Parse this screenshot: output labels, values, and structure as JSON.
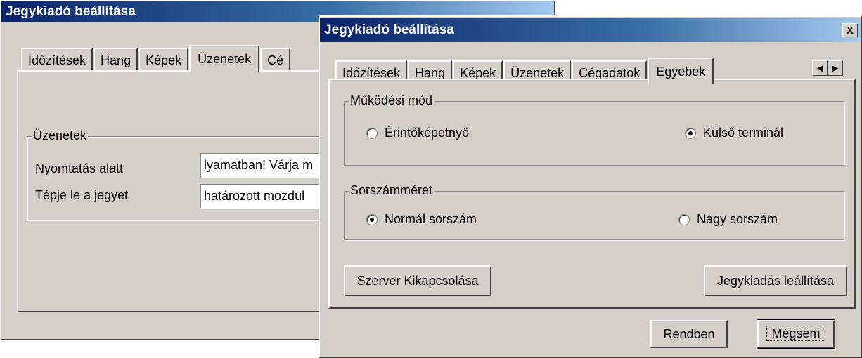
{
  "back_window": {
    "title": "Jegykiadó beállítása",
    "tabs": [
      "Időzítések",
      "Hang",
      "Képek",
      "Üzenetek",
      "Cé"
    ],
    "group_label": "Üzenetek",
    "rows": [
      {
        "label": "Nyomtatás alatt",
        "value": "lyamatban! Várja m"
      },
      {
        "label": "Tépje le a jegyet",
        "value": "határozott mozdul"
      }
    ]
  },
  "front_window": {
    "title": "Jegykiadó beállítása",
    "close_label": "X",
    "tabs": [
      "Időzítések",
      "Hang",
      "Képek",
      "Üzenetek",
      "Cégadatok",
      "Egyebek"
    ],
    "active_tab": "Egyebek",
    "scroll_left_icon": "◀",
    "scroll_right_icon": "▶",
    "mode_group": {
      "label": "Működési mód",
      "option_touch": "Érintőképetnyő",
      "option_external": "Külső terminál",
      "selected": "Külső terminál"
    },
    "size_group": {
      "label": "Sorszámméret",
      "option_normal": "Normál sorszám",
      "option_large": "Nagy sorszám",
      "selected": "Normál sorszám"
    },
    "server_off_button": "Szerver Kikapcsolása",
    "stop_ticketing_button": "Jegykiadás leállítása",
    "ok_button": "Rendben",
    "cancel_button": "Mégsem"
  }
}
